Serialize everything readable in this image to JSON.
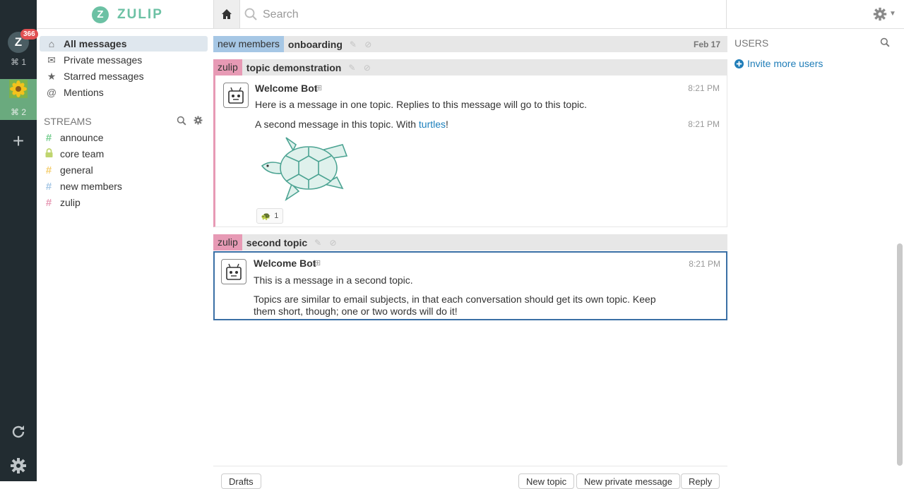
{
  "rail": {
    "server1_letter": "Z",
    "server1_badge": "366",
    "server1_shortcut": "⌘ 1",
    "server2_shortcut": "⌘ 2",
    "add_glyph": "+"
  },
  "header": {
    "brand_letter": "Z",
    "brand_name": "ZULIP",
    "search_placeholder": "Search",
    "home_icon": "home-icon",
    "settings_icon": "gear-icon"
  },
  "sidebar": {
    "nav": [
      {
        "label": "All messages",
        "icon": "home-icon",
        "glyph": "⌂"
      },
      {
        "label": "Private messages",
        "icon": "envelope-icon",
        "glyph": "✉"
      },
      {
        "label": "Starred messages",
        "icon": "star-icon",
        "glyph": "★"
      },
      {
        "label": "Mentions",
        "icon": "at-icon",
        "glyph": "@"
      }
    ],
    "streams_header": "STREAMS",
    "streams": [
      {
        "name": "announce",
        "glyph": "#",
        "color": "#76ce90"
      },
      {
        "name": "core team",
        "glyph": "🔒",
        "color": "#bfd56f"
      },
      {
        "name": "general",
        "glyph": "#",
        "color": "#f5ce6e"
      },
      {
        "name": "new members",
        "glyph": "#",
        "color": "#a6c7e5"
      },
      {
        "name": "zulip",
        "glyph": "#",
        "color": "#e79ab5"
      }
    ]
  },
  "messages": {
    "recipient1": {
      "stream": "new members",
      "topic": "onboarding",
      "date": "Feb 17",
      "stream_color": "#a6c7e5"
    },
    "recipient2": {
      "stream": "zulip",
      "topic": "topic demonstration",
      "stream_color": "#e79ab5"
    },
    "recipient3": {
      "stream": "zulip",
      "topic": "second topic",
      "stream_color": "#e79ab5"
    },
    "msg1": {
      "sender": "Welcome Bot",
      "time": "8:21 PM",
      "text": "Here is a message in one topic. Replies to this message will go to this topic."
    },
    "msg2": {
      "time": "8:21 PM",
      "text_before": "A second message in this topic. With ",
      "link": "turtles",
      "text_after": "!",
      "reaction_count": "1"
    },
    "msg3": {
      "sender": "Welcome Bot",
      "time": "8:21 PM",
      "text": "This is a message in a second topic.",
      "text2_line1": "Topics are similar to email subjects, in that each conversation should get its own topic. Keep",
      "text2_line2": "them short, though; one or two words will do it!"
    }
  },
  "compose": {
    "drafts": "Drafts",
    "new_topic": "New topic",
    "new_pm": "New private message",
    "reply": "Reply"
  },
  "right_sidebar": {
    "title": "USERS",
    "invite": "Invite more users"
  }
}
